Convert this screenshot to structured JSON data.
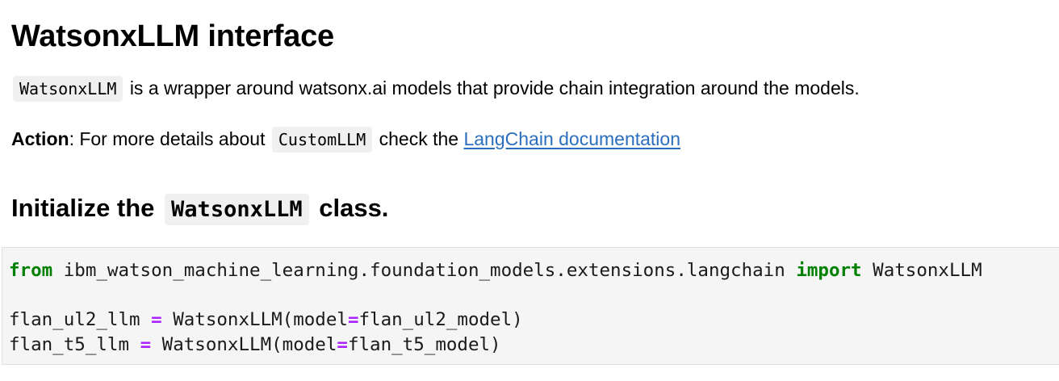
{
  "header": {
    "title": "WatsonxLLM interface"
  },
  "intro": {
    "code": "WatsonxLLM",
    "text": "is a wrapper around watsonx.ai models that provide chain integration around the models."
  },
  "action": {
    "label": "Action",
    "colon": ":",
    "text_before": "For more details about",
    "code": "CustomLLM",
    "text_after": "check the",
    "link_text": "LangChain documentation"
  },
  "section": {
    "prefix": "Initialize the",
    "code": "WatsonxLLM",
    "suffix": "class."
  },
  "code_block": {
    "line1": {
      "kw_from": "from",
      "module": " ibm_watson_machine_learning.foundation_models.extensions.langchain ",
      "kw_import": "import",
      "name": " WatsonxLLM"
    },
    "line2": {
      "var": "flan_ul2_llm ",
      "eq": "=",
      "call": " WatsonxLLM(model",
      "kw_eq": "=",
      "arg": "flan_ul2_model)"
    },
    "line3": {
      "var": "flan_t5_llm ",
      "eq": "=",
      "call": " WatsonxLLM(model",
      "kw_eq": "=",
      "arg": "flan_t5_model)"
    }
  },
  "colors": {
    "keyword": "#008000",
    "operator": "#aa22ff",
    "link": "#2a6ebd",
    "code_background": "#f5f5f5"
  }
}
